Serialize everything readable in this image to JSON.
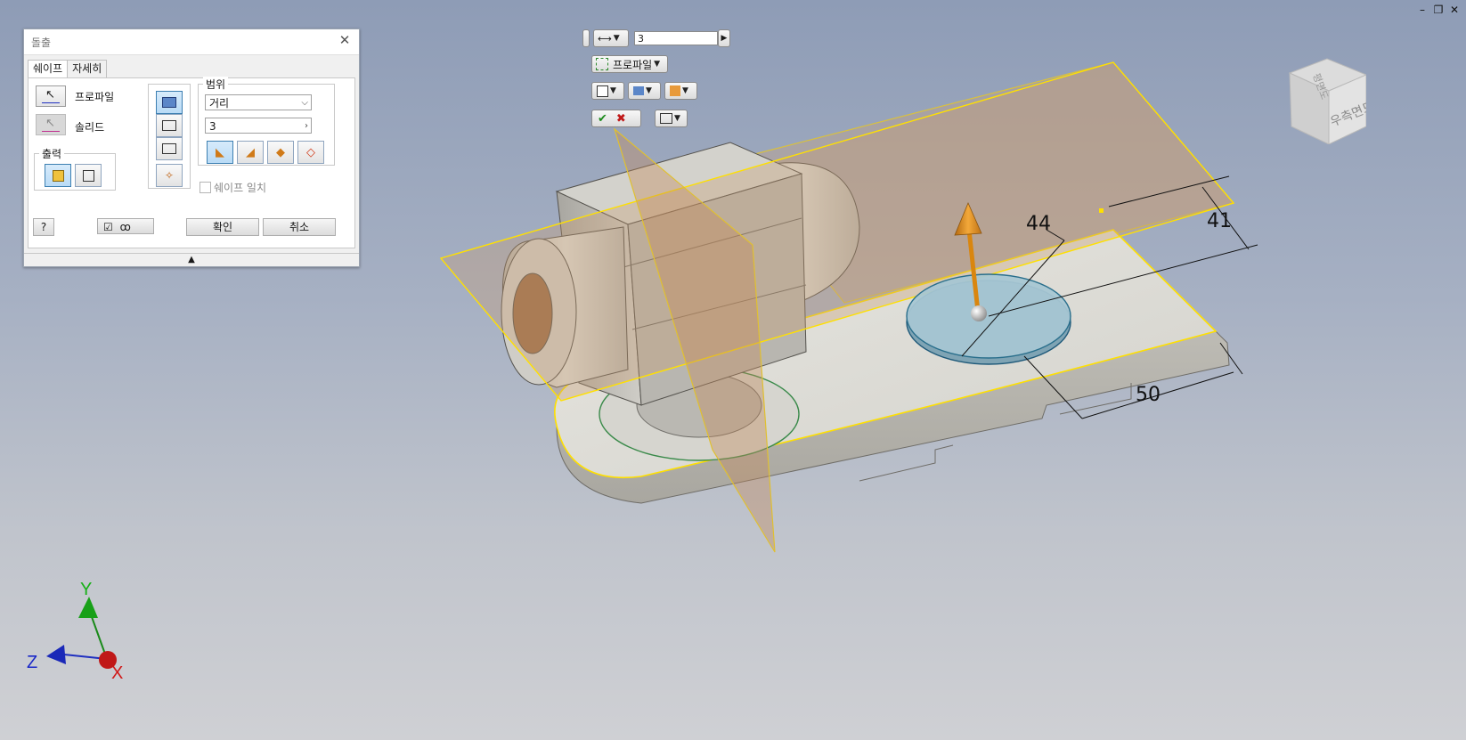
{
  "dialog": {
    "title": "돌출",
    "tabs": [
      {
        "label": "쉐이프"
      },
      {
        "label": "자세히"
      }
    ],
    "profile_label": "프로파일",
    "solid_label": "솔리드",
    "output_label": "출력",
    "extent": {
      "group_label": "범위",
      "type_value": "거리",
      "distance_value": "3"
    },
    "match_shape_label": "쉐이프 일치",
    "ok_label": "확인",
    "cancel_label": "취소",
    "collapse_glyph": "▲"
  },
  "minitoolbar": {
    "distance_value": "3",
    "profile_label": "프로파일"
  },
  "viewcube": {
    "face_label": "우측면도",
    "top_label": "평면도"
  },
  "dimensions": {
    "d1": "44",
    "d2": "41",
    "d3": "50"
  },
  "axis": {
    "x": "X",
    "y": "Y",
    "z": "Z"
  },
  "colors": {
    "accent": "#3c7fb1",
    "preview_plane": "#c79a6c",
    "edge_highlight": "#ffe000",
    "arrow": "#e08a1c"
  }
}
